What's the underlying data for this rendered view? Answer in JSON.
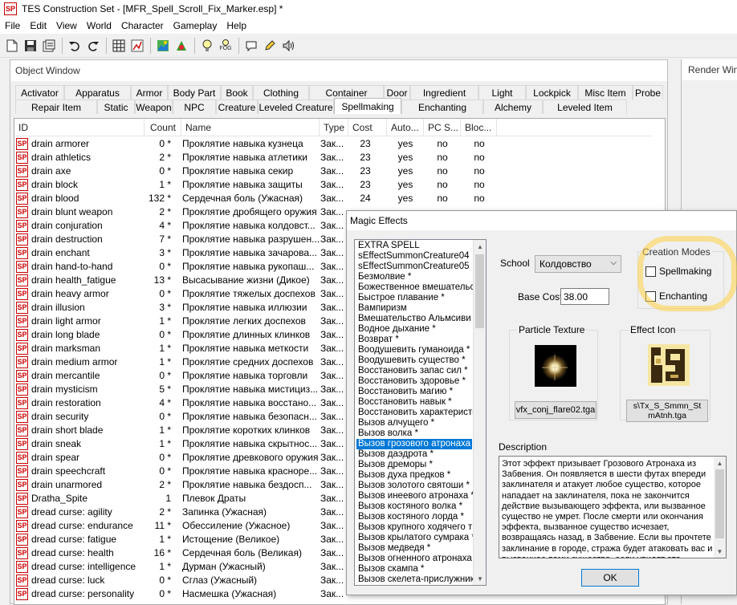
{
  "window": {
    "title": "TES Construction Set - [MFR_Spell_Scroll_Fix_Marker.esp] *"
  },
  "menu": [
    "File",
    "Edit",
    "View",
    "World",
    "Character",
    "Gameplay",
    "Help"
  ],
  "toolbar": {
    "icons": [
      "new-icon",
      "save-icon",
      "properties-icon",
      "undo-icon",
      "redo-icon",
      "grid-icon",
      "snap-icon",
      "landscape-icon",
      "render-icon",
      "light-icon",
      "fog-icon",
      "dialogue-icon",
      "pencil-icon",
      "sound-icon"
    ],
    "fog_label": "FOG"
  },
  "object_window": {
    "title": "Object Window",
    "tabs_row1": [
      "Activator",
      "Apparatus",
      "Armor",
      "Body Part",
      "Book",
      "Clothing",
      "Container",
      "Door",
      "Ingredient",
      "Light",
      "Lockpick",
      "Misc Item",
      "Probe"
    ],
    "tabs_row2": [
      "Repair Item",
      "Static",
      "Weapon",
      "NPC",
      "Creature",
      "Leveled Creature",
      "Spellmaking",
      "Enchanting",
      "Alchemy",
      "Leveled Item"
    ],
    "active_tab": "Spellmaking",
    "columns": [
      "ID",
      "Count",
      "Name",
      "Type",
      "Cost",
      "Auto...",
      "PC S...",
      "Bloc..."
    ],
    "icon_label": "SP",
    "rows": [
      {
        "id": "drain armorer",
        "count": "0 *",
        "name": "Проклятие навыка кузнеца",
        "type": "Зак...",
        "cost": "23",
        "auto": "yes",
        "pc": "no",
        "block": "no"
      },
      {
        "id": "drain athletics",
        "count": "2 *",
        "name": "Проклятие навыка атлетики",
        "type": "Зак...",
        "cost": "23",
        "auto": "yes",
        "pc": "no",
        "block": "no"
      },
      {
        "id": "drain axe",
        "count": "0 *",
        "name": "Проклятие навыка секир",
        "type": "Зак...",
        "cost": "23",
        "auto": "yes",
        "pc": "no",
        "block": "no"
      },
      {
        "id": "drain block",
        "count": "1 *",
        "name": "Проклятие навыка защиты",
        "type": "Зак...",
        "cost": "23",
        "auto": "yes",
        "pc": "no",
        "block": "no"
      },
      {
        "id": "drain blood",
        "count": "132 *",
        "name": "Сердечная боль (Ужасная)",
        "type": "Зак...",
        "cost": "24",
        "auto": "yes",
        "pc": "no",
        "block": "no"
      },
      {
        "id": "drain blunt weapon",
        "count": "2 *",
        "name": "Проклятие дробящего оружия",
        "type": "Зак...",
        "cost": "",
        "auto": "",
        "pc": "",
        "block": ""
      },
      {
        "id": "drain conjuration",
        "count": "4 *",
        "name": "Проклятие навыка колдовст...",
        "type": "Зак...",
        "cost": "",
        "auto": "",
        "pc": "",
        "block": ""
      },
      {
        "id": "drain destruction",
        "count": "7 *",
        "name": "Проклятие навыка разрушен...",
        "type": "Зак...",
        "cost": "",
        "auto": "",
        "pc": "",
        "block": ""
      },
      {
        "id": "drain enchant",
        "count": "3 *",
        "name": "Проклятие навыка зачарова...",
        "type": "Зак...",
        "cost": "",
        "auto": "",
        "pc": "",
        "block": ""
      },
      {
        "id": "drain hand-to-hand",
        "count": "0 *",
        "name": "Проклятие навыка рукопаш...",
        "type": "Зак...",
        "cost": "",
        "auto": "",
        "pc": "",
        "block": ""
      },
      {
        "id": "drain health_fatigue",
        "count": "13 *",
        "name": "Высасывание жизни (Дикое)",
        "type": "Зак...",
        "cost": "",
        "auto": "",
        "pc": "",
        "block": ""
      },
      {
        "id": "drain heavy armor",
        "count": "0 *",
        "name": "Проклятие тяжелых доспехов",
        "type": "Зак...",
        "cost": "",
        "auto": "",
        "pc": "",
        "block": ""
      },
      {
        "id": "drain illusion",
        "count": "3 *",
        "name": "Проклятие навыка иллюзии",
        "type": "Зак...",
        "cost": "",
        "auto": "",
        "pc": "",
        "block": ""
      },
      {
        "id": "drain light armor",
        "count": "1 *",
        "name": "Проклятие легких доспехов",
        "type": "Зак...",
        "cost": "",
        "auto": "",
        "pc": "",
        "block": ""
      },
      {
        "id": "drain long blade",
        "count": "0 *",
        "name": "Проклятие длинных клинков",
        "type": "Зак...",
        "cost": "",
        "auto": "",
        "pc": "",
        "block": ""
      },
      {
        "id": "drain marksman",
        "count": "1 *",
        "name": "Проклятие навыка меткости",
        "type": "Зак...",
        "cost": "",
        "auto": "",
        "pc": "",
        "block": ""
      },
      {
        "id": "drain medium armor",
        "count": "1 *",
        "name": "Проклятие средних доспехов",
        "type": "Зак...",
        "cost": "",
        "auto": "",
        "pc": "",
        "block": ""
      },
      {
        "id": "drain mercantile",
        "count": "0 *",
        "name": "Проклятие навыка торговли",
        "type": "Зак...",
        "cost": "",
        "auto": "",
        "pc": "",
        "block": ""
      },
      {
        "id": "drain mysticism",
        "count": "5 *",
        "name": "Проклятие навыка мистициз...",
        "type": "Зак...",
        "cost": "",
        "auto": "",
        "pc": "",
        "block": ""
      },
      {
        "id": "drain restoration",
        "count": "4 *",
        "name": "Проклятие навыка восстано...",
        "type": "Зак...",
        "cost": "",
        "auto": "",
        "pc": "",
        "block": ""
      },
      {
        "id": "drain security",
        "count": "0 *",
        "name": "Проклятие навыка безопасн...",
        "type": "Зак...",
        "cost": "",
        "auto": "",
        "pc": "",
        "block": ""
      },
      {
        "id": "drain short blade",
        "count": "1 *",
        "name": "Проклятие коротких клинков",
        "type": "Зак...",
        "cost": "",
        "auto": "",
        "pc": "",
        "block": ""
      },
      {
        "id": "drain sneak",
        "count": "1 *",
        "name": "Проклятие навыка скрытнос...",
        "type": "Зак...",
        "cost": "",
        "auto": "",
        "pc": "",
        "block": ""
      },
      {
        "id": "drain spear",
        "count": "0 *",
        "name": "Проклятие древкового оружия",
        "type": "Зак...",
        "cost": "",
        "auto": "",
        "pc": "",
        "block": ""
      },
      {
        "id": "drain speechcraft",
        "count": "0 *",
        "name": "Проклятие навыка красноре...",
        "type": "Зак...",
        "cost": "",
        "auto": "",
        "pc": "",
        "block": ""
      },
      {
        "id": "drain unarmored",
        "count": "2 *",
        "name": "Проклятие навыка бездосп...",
        "type": "Зак...",
        "cost": "",
        "auto": "",
        "pc": "",
        "block": ""
      },
      {
        "id": "Dratha_Spite",
        "count": "1",
        "name": "Плевок Драты",
        "type": "Зак...",
        "cost": "",
        "auto": "",
        "pc": "",
        "block": ""
      },
      {
        "id": "dread curse: agility",
        "count": "2 *",
        "name": "Запинка (Ужасная)",
        "type": "Зак...",
        "cost": "",
        "auto": "",
        "pc": "",
        "block": ""
      },
      {
        "id": "dread curse: endurance",
        "count": "11 *",
        "name": "Обессиление (Ужасное)",
        "type": "Зак...",
        "cost": "",
        "auto": "",
        "pc": "",
        "block": ""
      },
      {
        "id": "dread curse: fatigue",
        "count": "1 *",
        "name": "Истощение (Великое)",
        "type": "Зак...",
        "cost": "",
        "auto": "",
        "pc": "",
        "block": ""
      },
      {
        "id": "dread curse: health",
        "count": "16 *",
        "name": "Сердечная боль (Великая)",
        "type": "Зак...",
        "cost": "",
        "auto": "",
        "pc": "",
        "block": ""
      },
      {
        "id": "dread curse: intelligence",
        "count": "1 *",
        "name": "Дурман (Ужасный)",
        "type": "Зак...",
        "cost": "",
        "auto": "",
        "pc": "",
        "block": ""
      },
      {
        "id": "dread curse: luck",
        "count": "0 *",
        "name": "Сглаз (Ужасный)",
        "type": "Зак...",
        "cost": "",
        "auto": "",
        "pc": "",
        "block": ""
      },
      {
        "id": "dread curse: personality",
        "count": "0 *",
        "name": "Насмешка (Ужасная)",
        "type": "Зак...",
        "cost": "",
        "auto": "",
        "pc": "",
        "block": ""
      }
    ]
  },
  "render_window": {
    "title": "Render Win"
  },
  "magic_effects": {
    "title": "Magic Effects",
    "effects": [
      "EXTRA SPELL",
      "sEffectSummonCreature04",
      "sEffectSummonCreature05",
      "Безмолвие *",
      "Божественное вмешательство *",
      "Быстрое плавание *",
      "Вампиризм",
      "Вмешательство Альмсиви *",
      "Водное дыхание *",
      "Возврат *",
      "Воодушевить гуманоида *",
      "Воодушевить существо *",
      "Восстановить запас сил *",
      "Восстановить здоровье *",
      "Восстановить магию *",
      "Восстановить навык *",
      "Восстановить характеристику *",
      "Вызов алчущего *",
      "Вызов волка *",
      "Вызов грозового атронаха *",
      "Вызов даэдрота *",
      "Вызов дреморы *",
      "Вызов духа предков *",
      "Вызов золотого святоши *",
      "Вызов инеевого атронаха *",
      "Вызов костяного волка *",
      "Вызов костяного лорда *",
      "Вызов крупного ходячего трупа *",
      "Вызов крылатого сумрака *",
      "Вызов медведя *",
      "Вызов огненного атронаха *",
      "Вызов скампа *",
      "Вызов скелета-прислужника *"
    ],
    "selected": "Вызов грозового атронаха *",
    "school_label": "School",
    "school_value": "Колдовство",
    "base_cost_label": "Base Cost",
    "base_cost_value": "38.00",
    "creation_modes_label": "Creation Modes",
    "spellmaking_label": "Spellmaking",
    "enchanting_label": "Enchanting",
    "spellmaking_checked": false,
    "enchanting_checked": false,
    "particle_texture_label": "Particle Texture",
    "particle_texture_file": "vfx_conj_flare02.tga",
    "effect_icon_label": "Effect Icon",
    "effect_icon_file": "s\\Tx_S_Smmn_StmAtnh.tga",
    "description_label": "Description",
    "description": "Этот эффект призывает Грозового Атронаха из Забвения. Он появляется в шести футах впереди заклинателя и атакует любое существо, которое нападает на заклинателя, пока не закончится действие вызывающего эффекта, или вызванное существо не умрет. После смерти или окончания эффекта, вызванное существо исчезает, возвращаясь назад, в Забвение. Если вы прочтете заклинание в городе, стража будет атаковать вас и вызванное вами существо, если увидят это.",
    "ok_label": "OK"
  },
  "colors": {
    "selection": "#0078d7",
    "sp_icon": "#cc0000",
    "highlight": "#ffd246"
  }
}
